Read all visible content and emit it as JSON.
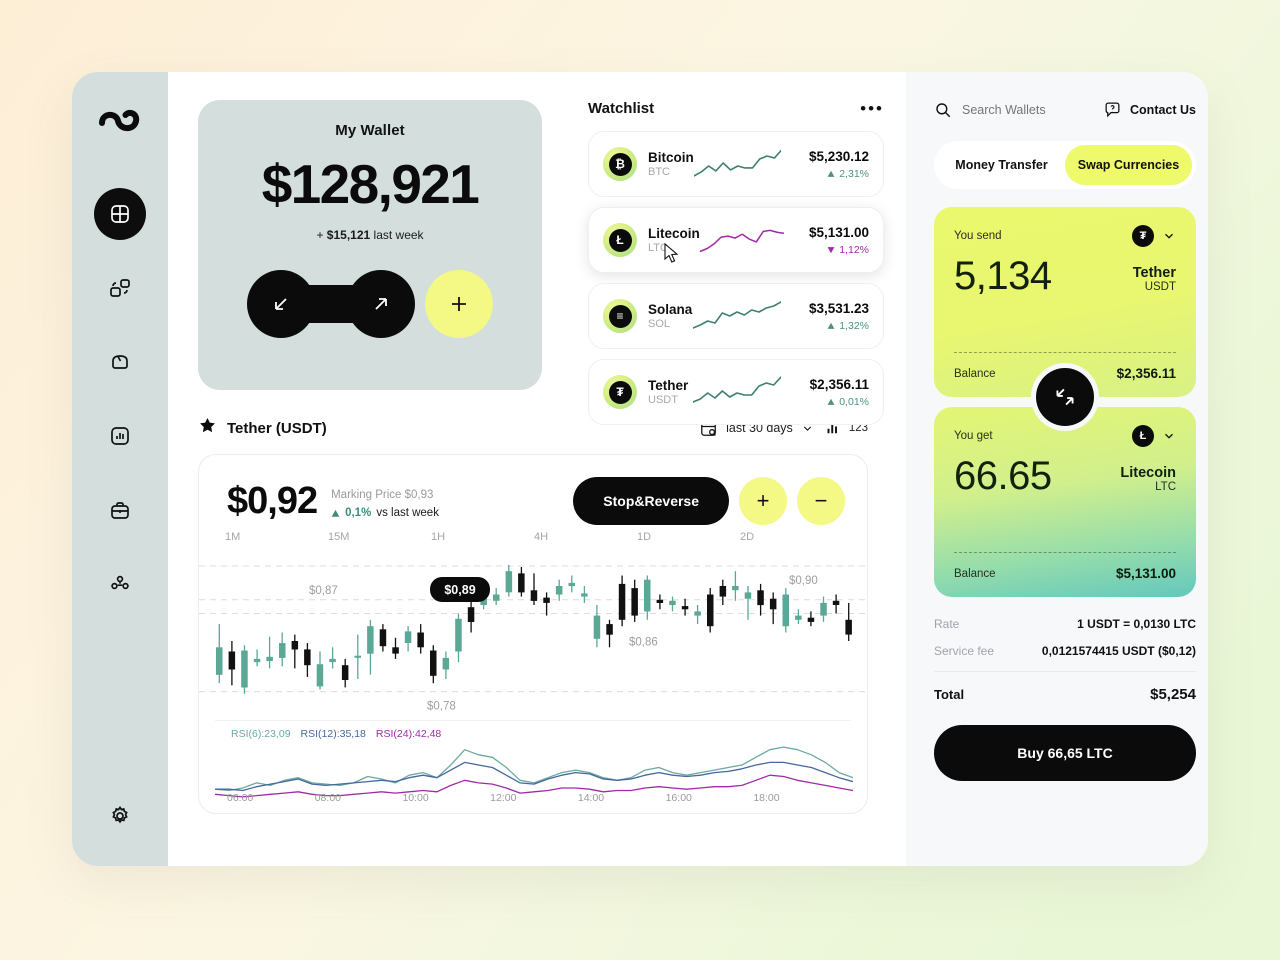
{
  "sidebar": {
    "logo_icon": "infinity-knot-logo",
    "items": [
      {
        "name": "dashboard",
        "icon": "dashboard-grid-icon",
        "active": true
      },
      {
        "name": "cards",
        "icon": "cards-icon",
        "active": false
      },
      {
        "name": "wallet",
        "icon": "wallet-icon",
        "active": false
      },
      {
        "name": "analytics",
        "icon": "bar-chart-icon",
        "active": false
      },
      {
        "name": "portfolio",
        "icon": "briefcase-icon",
        "active": false
      },
      {
        "name": "team",
        "icon": "users-group-icon",
        "active": false
      }
    ],
    "settings_icon": "gear-icon"
  },
  "wallet": {
    "title": "My Wallet",
    "amount": "$128,921",
    "change_prefix": "+",
    "change_amount": "$15,121",
    "change_suffix": "last week",
    "receive_icon": "arrow-down-left-icon",
    "send_icon": "arrow-up-right-icon",
    "add_icon": "plus-icon"
  },
  "watchlist": {
    "title": "Watchlist",
    "menu_icon": "more-options-icon",
    "items": [
      {
        "name": "Bitcoin",
        "symbol": "BTC",
        "glyph": "₿",
        "price": "$5,230.12",
        "change": "2,31%",
        "direction": "up",
        "spark_color": "#3f7f72",
        "spark": [
          30,
          26,
          20,
          25,
          17,
          24,
          20,
          22,
          22,
          13,
          10,
          12,
          4
        ]
      },
      {
        "name": "Litecoin",
        "symbol": "LTC",
        "glyph": "Ł",
        "price": "$5,131.00",
        "change": "1,12%",
        "direction": "down",
        "spark_color": "#a02ba6",
        "spark": [
          30,
          27,
          22,
          15,
          14,
          16,
          12,
          17,
          20,
          9,
          8,
          10,
          11
        ]
      },
      {
        "name": "Solana",
        "symbol": "SOL",
        "glyph": "≡",
        "price": "$3,531.23",
        "change": "1,32%",
        "direction": "up",
        "spark_color": "#3f7f72",
        "spark": [
          30,
          27,
          23,
          25,
          15,
          18,
          14,
          17,
          12,
          14,
          10,
          8,
          4
        ]
      },
      {
        "name": "Tether",
        "symbol": "USDT",
        "glyph": "₮",
        "price": "$2,356.11",
        "change": "0,01%",
        "direction": "up",
        "spark_color": "#3f7f72",
        "spark": [
          28,
          25,
          19,
          24,
          17,
          23,
          19,
          21,
          21,
          12,
          9,
          11,
          3
        ]
      }
    ]
  },
  "chart_section": {
    "star_icon": "star-filled-icon",
    "title": "Tether (USDT)",
    "calendar_icon": "calendar-search-icon",
    "range_label": "last 30 days",
    "chevron_icon": "chevron-down-icon",
    "bars_icon": "bar-chart-icon",
    "count": "123"
  },
  "chart_data": {
    "type": "candlestick",
    "title": "Tether (USDT)",
    "price": "$0,92",
    "marking_price_label": "Marking Price",
    "marking_price": "$0,93",
    "change": "0,1%",
    "change_direction": "up",
    "change_context": "vs last week",
    "actions": {
      "stop_reverse": "Stop&Reverse",
      "zoom_in": "+",
      "zoom_out": "−"
    },
    "timeframes": [
      "1M",
      "15M",
      "1H",
      "4H",
      "1D",
      "2D"
    ],
    "gridline_labels": [
      "$0,90",
      "$0,87",
      "$0,86",
      "$0,78"
    ],
    "tooltip": "$0,89",
    "ylim": [
      0.76,
      0.92
    ],
    "up_color": "#5ba896",
    "down_color": "#111111",
    "candles": [
      {
        "o": 0.8,
        "c": 0.826,
        "h": 0.848,
        "l": 0.792,
        "d": "u"
      },
      {
        "o": 0.822,
        "c": 0.805,
        "h": 0.832,
        "l": 0.79,
        "d": "d"
      },
      {
        "o": 0.823,
        "c": 0.788,
        "h": 0.828,
        "l": 0.782,
        "d": "u"
      },
      {
        "o": 0.812,
        "c": 0.815,
        "h": 0.824,
        "l": 0.808,
        "d": "u"
      },
      {
        "o": 0.813,
        "c": 0.817,
        "h": 0.836,
        "l": 0.806,
        "d": "u"
      },
      {
        "o": 0.816,
        "c": 0.83,
        "h": 0.84,
        "l": 0.808,
        "d": "u"
      },
      {
        "o": 0.832,
        "c": 0.824,
        "h": 0.838,
        "l": 0.806,
        "d": "d"
      },
      {
        "o": 0.824,
        "c": 0.809,
        "h": 0.83,
        "l": 0.798,
        "d": "d"
      },
      {
        "o": 0.81,
        "c": 0.789,
        "h": 0.822,
        "l": 0.786,
        "d": "u"
      },
      {
        "o": 0.812,
        "c": 0.815,
        "h": 0.826,
        "l": 0.806,
        "d": "u"
      },
      {
        "o": 0.809,
        "c": 0.795,
        "h": 0.815,
        "l": 0.788,
        "d": "d"
      },
      {
        "o": 0.816,
        "c": 0.818,
        "h": 0.838,
        "l": 0.796,
        "d": "u"
      },
      {
        "o": 0.82,
        "c": 0.846,
        "h": 0.852,
        "l": 0.8,
        "d": "u"
      },
      {
        "o": 0.843,
        "c": 0.827,
        "h": 0.848,
        "l": 0.822,
        "d": "d"
      },
      {
        "o": 0.826,
        "c": 0.82,
        "h": 0.835,
        "l": 0.815,
        "d": "d"
      },
      {
        "o": 0.83,
        "c": 0.841,
        "h": 0.846,
        "l": 0.822,
        "d": "u"
      },
      {
        "o": 0.84,
        "c": 0.826,
        "h": 0.848,
        "l": 0.82,
        "d": "d"
      },
      {
        "o": 0.823,
        "c": 0.799,
        "h": 0.828,
        "l": 0.792,
        "d": "d"
      },
      {
        "o": 0.805,
        "c": 0.816,
        "h": 0.822,
        "l": 0.796,
        "d": "u"
      },
      {
        "o": 0.822,
        "c": 0.853,
        "h": 0.858,
        "l": 0.812,
        "d": "u"
      },
      {
        "o": 0.85,
        "c": 0.864,
        "h": 0.87,
        "l": 0.84,
        "d": "d"
      },
      {
        "o": 0.866,
        "c": 0.873,
        "h": 0.878,
        "l": 0.862,
        "d": "u"
      },
      {
        "o": 0.87,
        "c": 0.876,
        "h": 0.882,
        "l": 0.866,
        "d": "u"
      },
      {
        "o": 0.878,
        "c": 0.898,
        "h": 0.904,
        "l": 0.874,
        "d": "u"
      },
      {
        "o": 0.896,
        "c": 0.878,
        "h": 0.902,
        "l": 0.874,
        "d": "d"
      },
      {
        "o": 0.88,
        "c": 0.87,
        "h": 0.896,
        "l": 0.866,
        "d": "d"
      },
      {
        "o": 0.868,
        "c": 0.873,
        "h": 0.878,
        "l": 0.856,
        "d": "d"
      },
      {
        "o": 0.876,
        "c": 0.884,
        "h": 0.89,
        "l": 0.87,
        "d": "u"
      },
      {
        "o": 0.884,
        "c": 0.887,
        "h": 0.894,
        "l": 0.878,
        "d": "u"
      },
      {
        "o": 0.874,
        "c": 0.877,
        "h": 0.884,
        "l": 0.868,
        "d": "u"
      },
      {
        "o": 0.856,
        "c": 0.834,
        "h": 0.866,
        "l": 0.826,
        "d": "u"
      },
      {
        "o": 0.838,
        "c": 0.848,
        "h": 0.852,
        "l": 0.826,
        "d": "d"
      },
      {
        "o": 0.852,
        "c": 0.886,
        "h": 0.894,
        "l": 0.846,
        "d": "d"
      },
      {
        "o": 0.882,
        "c": 0.856,
        "h": 0.89,
        "l": 0.85,
        "d": "d"
      },
      {
        "o": 0.86,
        "c": 0.89,
        "h": 0.894,
        "l": 0.852,
        "d": "u"
      },
      {
        "o": 0.868,
        "c": 0.871,
        "h": 0.876,
        "l": 0.862,
        "d": "d"
      },
      {
        "o": 0.866,
        "c": 0.87,
        "h": 0.874,
        "l": 0.86,
        "d": "u"
      },
      {
        "o": 0.862,
        "c": 0.865,
        "h": 0.872,
        "l": 0.856,
        "d": "d"
      },
      {
        "o": 0.856,
        "c": 0.86,
        "h": 0.866,
        "l": 0.848,
        "d": "u"
      },
      {
        "o": 0.846,
        "c": 0.876,
        "h": 0.882,
        "l": 0.84,
        "d": "d"
      },
      {
        "o": 0.874,
        "c": 0.884,
        "h": 0.89,
        "l": 0.866,
        "d": "d"
      },
      {
        "o": 0.88,
        "c": 0.884,
        "h": 0.898,
        "l": 0.87,
        "d": "u"
      },
      {
        "o": 0.872,
        "c": 0.878,
        "h": 0.884,
        "l": 0.852,
        "d": "u"
      },
      {
        "o": 0.866,
        "c": 0.88,
        "h": 0.886,
        "l": 0.856,
        "d": "d"
      },
      {
        "o": 0.862,
        "c": 0.872,
        "h": 0.878,
        "l": 0.848,
        "d": "d"
      },
      {
        "o": 0.846,
        "c": 0.876,
        "h": 0.882,
        "l": 0.84,
        "d": "u"
      },
      {
        "o": 0.852,
        "c": 0.856,
        "h": 0.862,
        "l": 0.848,
        "d": "u"
      },
      {
        "o": 0.85,
        "c": 0.854,
        "h": 0.86,
        "l": 0.846,
        "d": "d"
      },
      {
        "o": 0.856,
        "c": 0.868,
        "h": 0.874,
        "l": 0.85,
        "d": "u"
      },
      {
        "o": 0.866,
        "c": 0.87,
        "h": 0.876,
        "l": 0.858,
        "d": "d"
      },
      {
        "o": 0.852,
        "c": 0.838,
        "h": 0.868,
        "l": 0.832,
        "d": "d"
      }
    ],
    "rsi": {
      "series": [
        {
          "name": "RSI(6)",
          "value": "23,09",
          "color": "#6aa9a2"
        },
        {
          "name": "RSI(12)",
          "value": "35,18",
          "color": "#46689b"
        },
        {
          "name": "RSI(24)",
          "value": "42,48",
          "color": "#a02ba6"
        }
      ],
      "rsi6": [
        17,
        16,
        18,
        22,
        20,
        24,
        26,
        22,
        21,
        20,
        22,
        27,
        25,
        22,
        28,
        30,
        26,
        36,
        48,
        44,
        42,
        34,
        24,
        22,
        26,
        30,
        32,
        30,
        26,
        24,
        26,
        32,
        34,
        30,
        28,
        30,
        32,
        34,
        36,
        42,
        48,
        50,
        48,
        44,
        38,
        30,
        26
      ],
      "rsi12": [
        17,
        17,
        16,
        19,
        21,
        23,
        25,
        21,
        20,
        21,
        22,
        23,
        24,
        23,
        26,
        28,
        26,
        32,
        38,
        36,
        34,
        28,
        22,
        21,
        25,
        28,
        30,
        29,
        25,
        24,
        25,
        28,
        30,
        28,
        27,
        28,
        30,
        31,
        33,
        36,
        38,
        38,
        36,
        34,
        30,
        26,
        23
      ],
      "rsi24": [
        13,
        12,
        11,
        12,
        13,
        14,
        15,
        13,
        12,
        12,
        13,
        14,
        15,
        14,
        15,
        16,
        15,
        20,
        24,
        22,
        21,
        18,
        14,
        15,
        16,
        18,
        18,
        17,
        15,
        16,
        16,
        18,
        19,
        18,
        17,
        18,
        19,
        19,
        20,
        24,
        28,
        27,
        24,
        22,
        20,
        18,
        16
      ],
      "xticks": [
        "06:00",
        "08:00",
        "10:00",
        "12:00",
        "14:00",
        "16:00",
        "18:00"
      ]
    }
  },
  "right_panel": {
    "search_icon": "search-icon",
    "search_placeholder": "Search Wallets",
    "help_icon": "help-chat-icon",
    "contact_label": "Contact Us",
    "tabs": [
      {
        "label": "Money Transfer",
        "active": false
      },
      {
        "label": "Swap Currencies",
        "active": true
      }
    ],
    "send": {
      "label": "You send",
      "amount": "5,134",
      "currency_name": "Tether",
      "currency_symbol": "USDT",
      "currency_glyph": "₮",
      "balance_label": "Balance",
      "balance_value": "$2,356.11",
      "chevron_icon": "chevron-down-icon"
    },
    "swap_icon": "swap-arrows-icon",
    "get": {
      "label": "You get",
      "amount": "66.65",
      "currency_name": "Litecoin",
      "currency_symbol": "LTC",
      "currency_glyph": "Ł",
      "balance_label": "Balance",
      "balance_value": "$5,131.00",
      "chevron_icon": "chevron-down-icon"
    },
    "rate_label": "Rate",
    "rate_value": "1 USDT = 0,0130 LTC",
    "fee_label": "Service fee",
    "fee_value": "0,0121574415 USDT ($0,12)",
    "total_label": "Total",
    "total_value": "$5,254",
    "buy_label": "Buy 66,65 LTC"
  }
}
